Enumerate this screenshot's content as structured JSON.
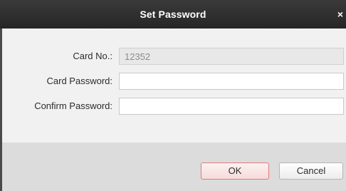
{
  "dialog": {
    "title": "Set Password",
    "close_glyph": "×"
  },
  "form": {
    "card_no_label": "Card No.:",
    "card_no_value": "12352",
    "card_password_label": "Card Password:",
    "card_password_value": "",
    "confirm_password_label": "Confirm Password:",
    "confirm_password_value": ""
  },
  "buttons": {
    "ok_label": "OK",
    "cancel_label": "Cancel"
  },
  "colors": {
    "titlebar": "#2e2e2e",
    "ok_border": "#e07b7b"
  }
}
